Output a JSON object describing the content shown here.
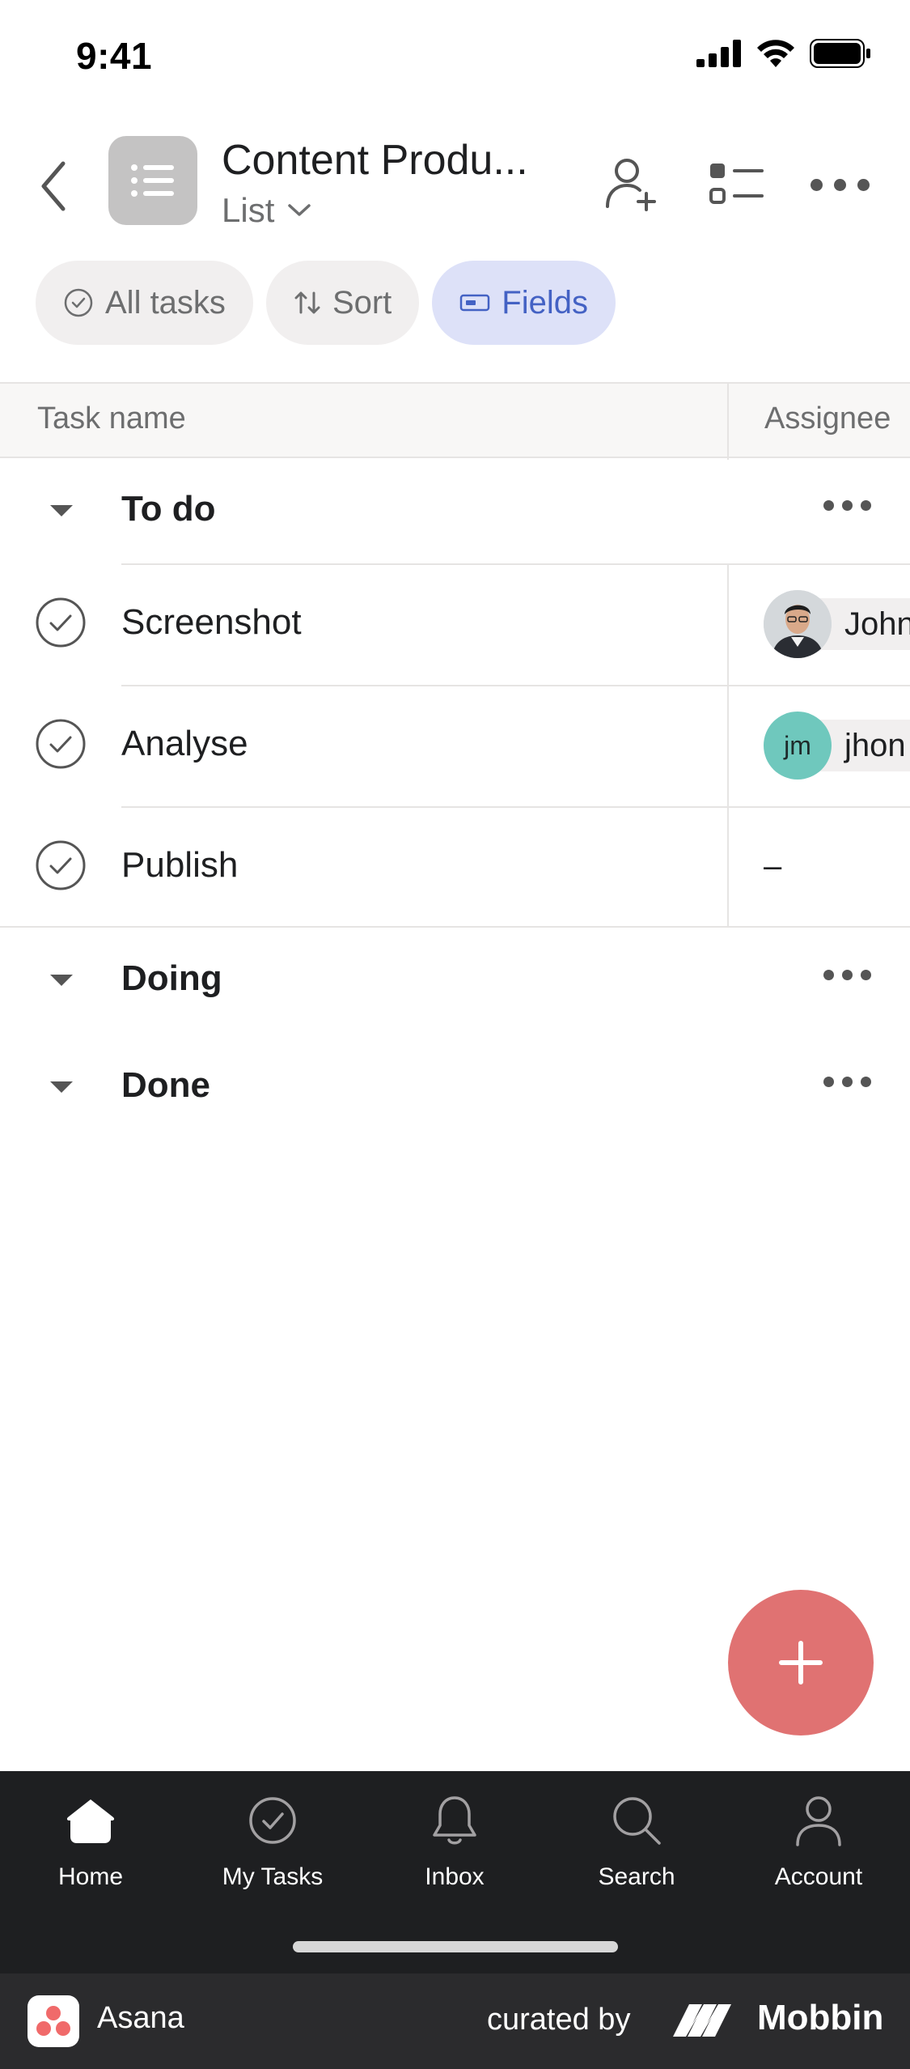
{
  "status_bar": {
    "time": "9:41"
  },
  "header": {
    "project_title": "Content Produ...",
    "view_label": "List"
  },
  "filters": {
    "all_tasks": "All tasks",
    "sort": "Sort",
    "fields": "Fields"
  },
  "table": {
    "col_task": "Task name",
    "col_assignee": "Assignee"
  },
  "sections": [
    {
      "name": "To do",
      "tasks": [
        {
          "name": "Screenshot",
          "assignee": "John",
          "avatar_type": "photo"
        },
        {
          "name": "Analyse",
          "assignee": "jhon",
          "avatar_initials": "jm",
          "avatar_type": "initials"
        },
        {
          "name": "Publish",
          "assignee": "–"
        }
      ]
    },
    {
      "name": "Doing"
    },
    {
      "name": "Done"
    }
  ],
  "tab_bar": [
    {
      "label": "Home",
      "icon": "home-icon"
    },
    {
      "label": "My Tasks",
      "icon": "check-circle-icon"
    },
    {
      "label": "Inbox",
      "icon": "bell-icon"
    },
    {
      "label": "Search",
      "icon": "search-icon"
    },
    {
      "label": "Account",
      "icon": "person-icon"
    }
  ],
  "footer": {
    "app_name": "Asana",
    "curated_by": "curated by",
    "brand": "Mobbin"
  },
  "colors": {
    "fab": "#e07272",
    "fields_chip_bg": "#dde1f8",
    "fields_chip_text": "#4462c4",
    "tab_bar_bg": "#1e1f21",
    "avatar_jm": "#6fc8bd"
  }
}
